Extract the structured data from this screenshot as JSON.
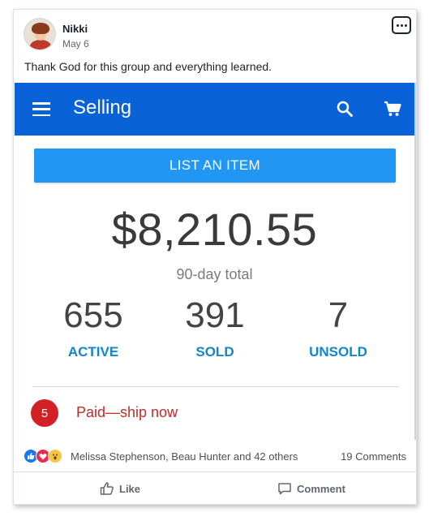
{
  "post": {
    "author": "Nikki",
    "date": "May 6",
    "text": "Thank God for this group and everything learned."
  },
  "app": {
    "title": "Selling",
    "list_button": "LIST AN ITEM",
    "total": "$8,210.55",
    "total_label": "90-day total",
    "stats": [
      {
        "value": "655",
        "label": "ACTIVE"
      },
      {
        "value": "391",
        "label": "SOLD"
      },
      {
        "value": "7",
        "label": "UNSOLD"
      }
    ],
    "task_count": "5",
    "task_text": "Paid—ship now",
    "colors": {
      "app_bar": "#0a62d8",
      "button": "#2196f3",
      "label": "#1186c9",
      "alert": "#d32027"
    }
  },
  "footer": {
    "reaction_names": "Melissa Stephenson, Beau Hunter and 42 others",
    "comments": "19 Comments",
    "like_label": "Like",
    "comment_label": "Comment"
  },
  "icons": [
    "avatar",
    "more-options-icon",
    "menu-icon",
    "search-icon",
    "cart-icon",
    "like-reaction-icon",
    "love-reaction-icon",
    "wow-reaction-icon",
    "thumbs-up-icon",
    "comment-icon"
  ]
}
